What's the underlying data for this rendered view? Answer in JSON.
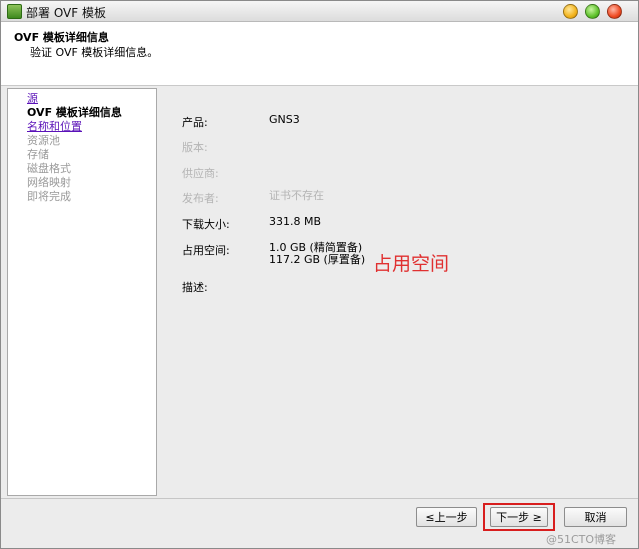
{
  "window": {
    "title": "部署 OVF 模板"
  },
  "header": {
    "title": "OVF 模板详细信息",
    "subtitle": "验证 OVF 模板详细信息。"
  },
  "nav": {
    "items": [
      {
        "label": "源",
        "state": "link"
      },
      {
        "label": "OVF 模板详细信息",
        "state": "current"
      },
      {
        "label": "名称和位置",
        "state": "link"
      },
      {
        "label": "资源池",
        "state": "disabled"
      },
      {
        "label": "存储",
        "state": "disabled"
      },
      {
        "label": "磁盘格式",
        "state": "disabled"
      },
      {
        "label": "网络映射",
        "state": "disabled"
      },
      {
        "label": "即将完成",
        "state": "disabled"
      }
    ]
  },
  "details": {
    "product_label": "产品:",
    "product_value": "GNS3",
    "version_label": "版本:",
    "vendor_label": "供应商:",
    "publisher_label": "发布者:",
    "publisher_value": "证书不存在",
    "download_label": "下载大小:",
    "download_value": "331.8 MB",
    "disk_label": "占用空间:",
    "disk_thin": "1.0 GB (精简置备)",
    "disk_thick": "117.2 GB (厚置备)",
    "description_label": "描述:"
  },
  "annotation": "占用空间",
  "buttons": {
    "back": "≤上一步",
    "next": "下一步 ≥",
    "cancel": "取消"
  },
  "watermark": "@51CTO博客",
  "colors": {
    "link": "#5a12b8",
    "annotation": "#e03030",
    "highlight": "#d81e1e"
  }
}
